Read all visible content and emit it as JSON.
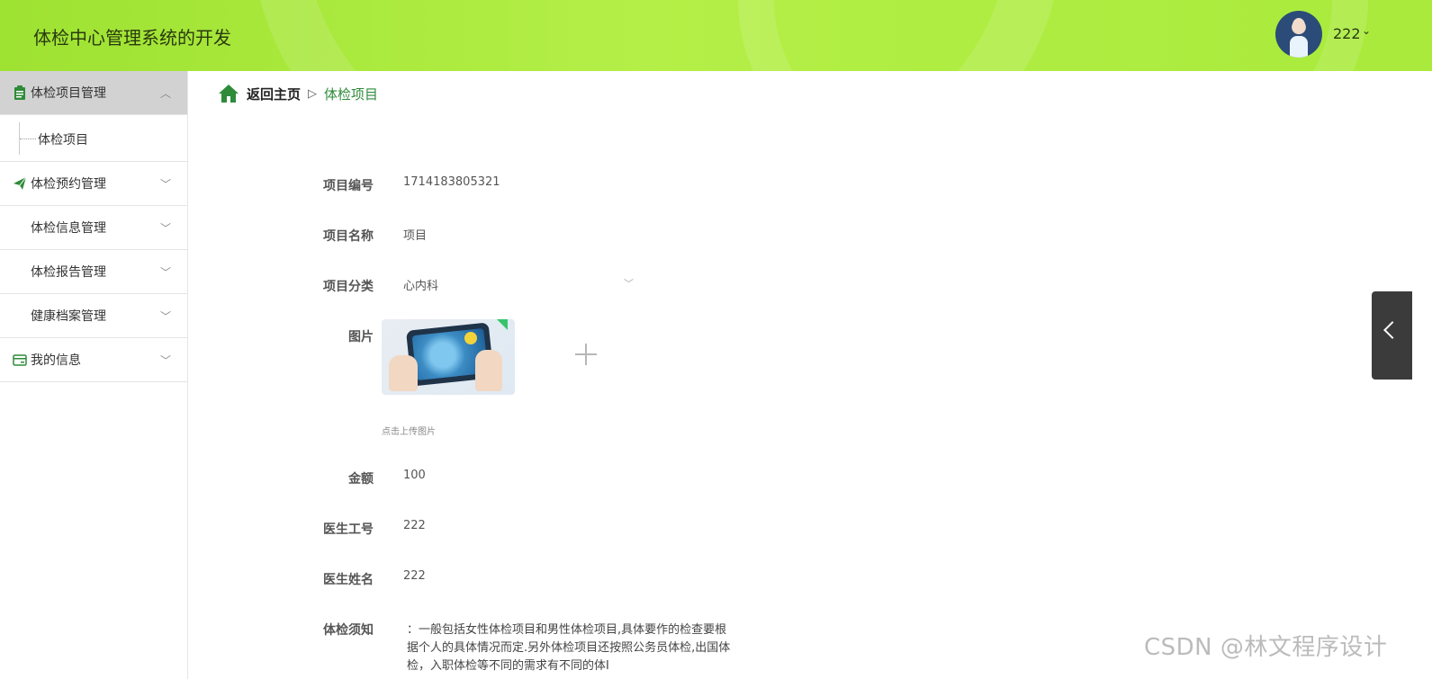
{
  "header": {
    "app_title": "体检中心管理系统的开发",
    "user_name": "222",
    "user_caret": "⌄"
  },
  "sidebar": {
    "items": [
      {
        "label": "体检项目管理",
        "icon": "clipboard-icon",
        "expanded": true
      },
      {
        "label": "体检预约管理",
        "icon": "send-icon"
      },
      {
        "label": "体检信息管理",
        "icon": "grid-icon"
      },
      {
        "label": "体检报告管理",
        "icon": "grid-icon"
      },
      {
        "label": "健康档案管理",
        "icon": "grid-icon"
      },
      {
        "label": "我的信息",
        "icon": "card-icon"
      }
    ],
    "submenu_label": "体检项目",
    "chevron_up": "︿",
    "chevron_down": "﹀"
  },
  "breadcrumb": {
    "home": "返回主页",
    "separator": "▷",
    "current": "体检项目"
  },
  "form": {
    "project_no": {
      "label": "项目编号",
      "value": "1714183805321"
    },
    "project_name": {
      "label": "项目名称",
      "value": "项目"
    },
    "category": {
      "label": "项目分类",
      "value": "心内科"
    },
    "image": {
      "label": "图片",
      "hint": "点击上传图片"
    },
    "amount": {
      "label": "金额",
      "value": "100"
    },
    "doctor_id": {
      "label": "医生工号",
      "value": "222"
    },
    "doctor_name": {
      "label": "医生姓名",
      "value": "222"
    },
    "notice": {
      "label": "体检须知",
      "value": "：一般包括女性体检项目和男性体检项目,具体要作的检查要根据个人的具体情况而定.另外体检项目还按照公务员体检,出国体检，入职体检等不同的需求有不同的体I"
    }
  },
  "watermark": "CSDN @林文程序设计",
  "colors": {
    "accent": "#2e8b3a",
    "header_green": "#b4ef47",
    "active_menu_bg": "#d2d2d2"
  }
}
